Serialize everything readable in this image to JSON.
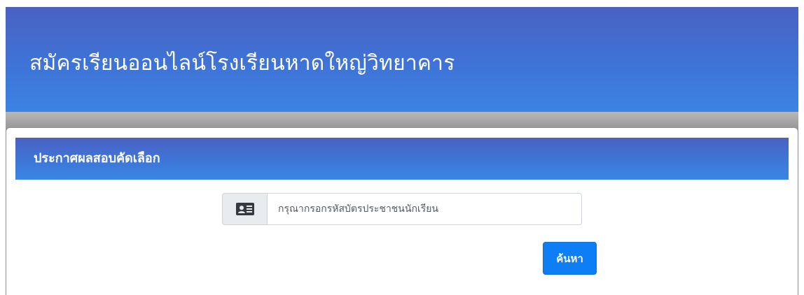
{
  "header": {
    "title": "สมัครเรียนออนไลน์โรงเรียนหาดใหญ่วิทยาคาร"
  },
  "card": {
    "title": "ประกาศผลสอบคัดเลือก"
  },
  "search": {
    "icon": "id-card-icon",
    "placeholder": "กรุณากรอกรหัสบัตรประชาชนนักเรียน",
    "value": "",
    "button_label": "ค้นหา"
  },
  "colors": {
    "header_gradient_top": "#4a61c2",
    "header_gradient_bottom": "#3b84e2",
    "button": "#0d7ef5",
    "page_band": "#9c9c9c"
  }
}
